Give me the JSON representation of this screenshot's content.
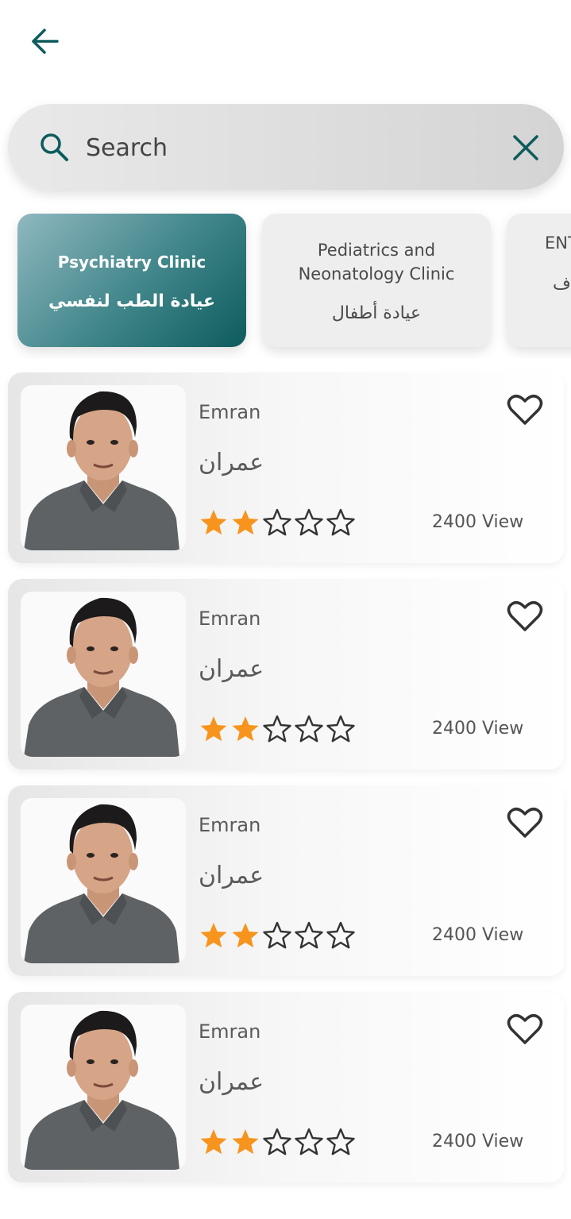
{
  "header": {
    "back_icon": "arrow-left-icon"
  },
  "search": {
    "placeholder": "Search",
    "value": "",
    "search_icon": "search-icon",
    "clear_icon": "close-icon"
  },
  "categories": [
    {
      "name_en": "Psychiatry Clinic",
      "name_ar": "عيادة الطب لنفسي",
      "active": true
    },
    {
      "name_en": "Pediatrics and Neonatology Clinic",
      "name_ar": "عيادة أطفال",
      "active": false
    },
    {
      "name_en": "ENT",
      "name_ar": "ف",
      "active": false
    }
  ],
  "doctors": [
    {
      "name_en": "Emran",
      "name_ar": "عمران",
      "rating": 2,
      "rating_max": 5,
      "views": "2400 View"
    },
    {
      "name_en": "Emran",
      "name_ar": "عمران",
      "rating": 2,
      "rating_max": 5,
      "views": "2400 View"
    },
    {
      "name_en": "Emran",
      "name_ar": "عمران",
      "rating": 2,
      "rating_max": 5,
      "views": "2400 View"
    },
    {
      "name_en": "Emran",
      "name_ar": "عمران",
      "rating": 2,
      "rating_max": 5,
      "views": "2400 View"
    }
  ],
  "colors": {
    "accent": "#0d5b5d",
    "star_filled": "#f7941d",
    "star_empty": "#333333"
  }
}
